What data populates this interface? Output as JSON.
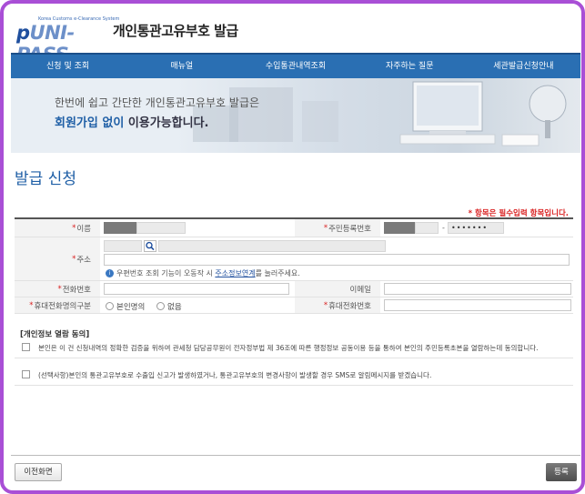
{
  "header": {
    "logo_tagline": "Korea Customs e-Clearance System",
    "logo_p": "p",
    "logo_rest": "UNI-PASS",
    "title": "개인통관고유부호 발급"
  },
  "nav": {
    "items": [
      "신청 및 조회",
      "매뉴얼",
      "수입통관내역조회",
      "자주하는 질문",
      "세관발급신청안내"
    ]
  },
  "banner": {
    "line1": "한번에 쉽고 간단한 개인통관고유부호 발급은",
    "line2_highlight": "회원가입 없이",
    "line2_rest": " 이용가능합니다."
  },
  "page_title": "발급 신청",
  "required_note": "* 항목은 필수입력 항목입니다.",
  "form": {
    "name_label": "이름",
    "rrn_label": "주민등록번호",
    "rrn_separator": "-",
    "rrn_back_value": "•••••••",
    "address_label": "주소",
    "address_note_prefix": "우편번호 조회 기능이 오동작 시 ",
    "address_note_link": "주소정보연계",
    "address_note_suffix": "를 눌러주세요.",
    "phone_label": "전화번호",
    "email_label": "이메일",
    "mobile_type_label": "휴대전화명의구분",
    "mobile_type_options": [
      "본인명의",
      "없음"
    ],
    "mobile_label": "휴대전화번호"
  },
  "consent": {
    "title": "[개인정보 열람 동의]",
    "item1": "본인은 이 건 신청내역의 정확한 검증을 위하여 관세청 담당공무원이 전자정부법 제 36조에 따른 행정정보 공동이용 등을 통하여 본인의 주민등록초본을 열람하는데 동의합니다.",
    "item2": "(선택사항)본인의 통관고유부호로 수출입 신고가 발생하였거나, 통관고유부호의 변경사항이 발생할 경우 SMS로 알림메시지를 받겠습니다."
  },
  "buttons": {
    "prev": "이전화면",
    "submit": "등록"
  },
  "colors": {
    "frame": "#a94fd6",
    "nav": "#2a6fb3",
    "title_blue": "#1f5fa6",
    "required_red": "#d92020"
  }
}
